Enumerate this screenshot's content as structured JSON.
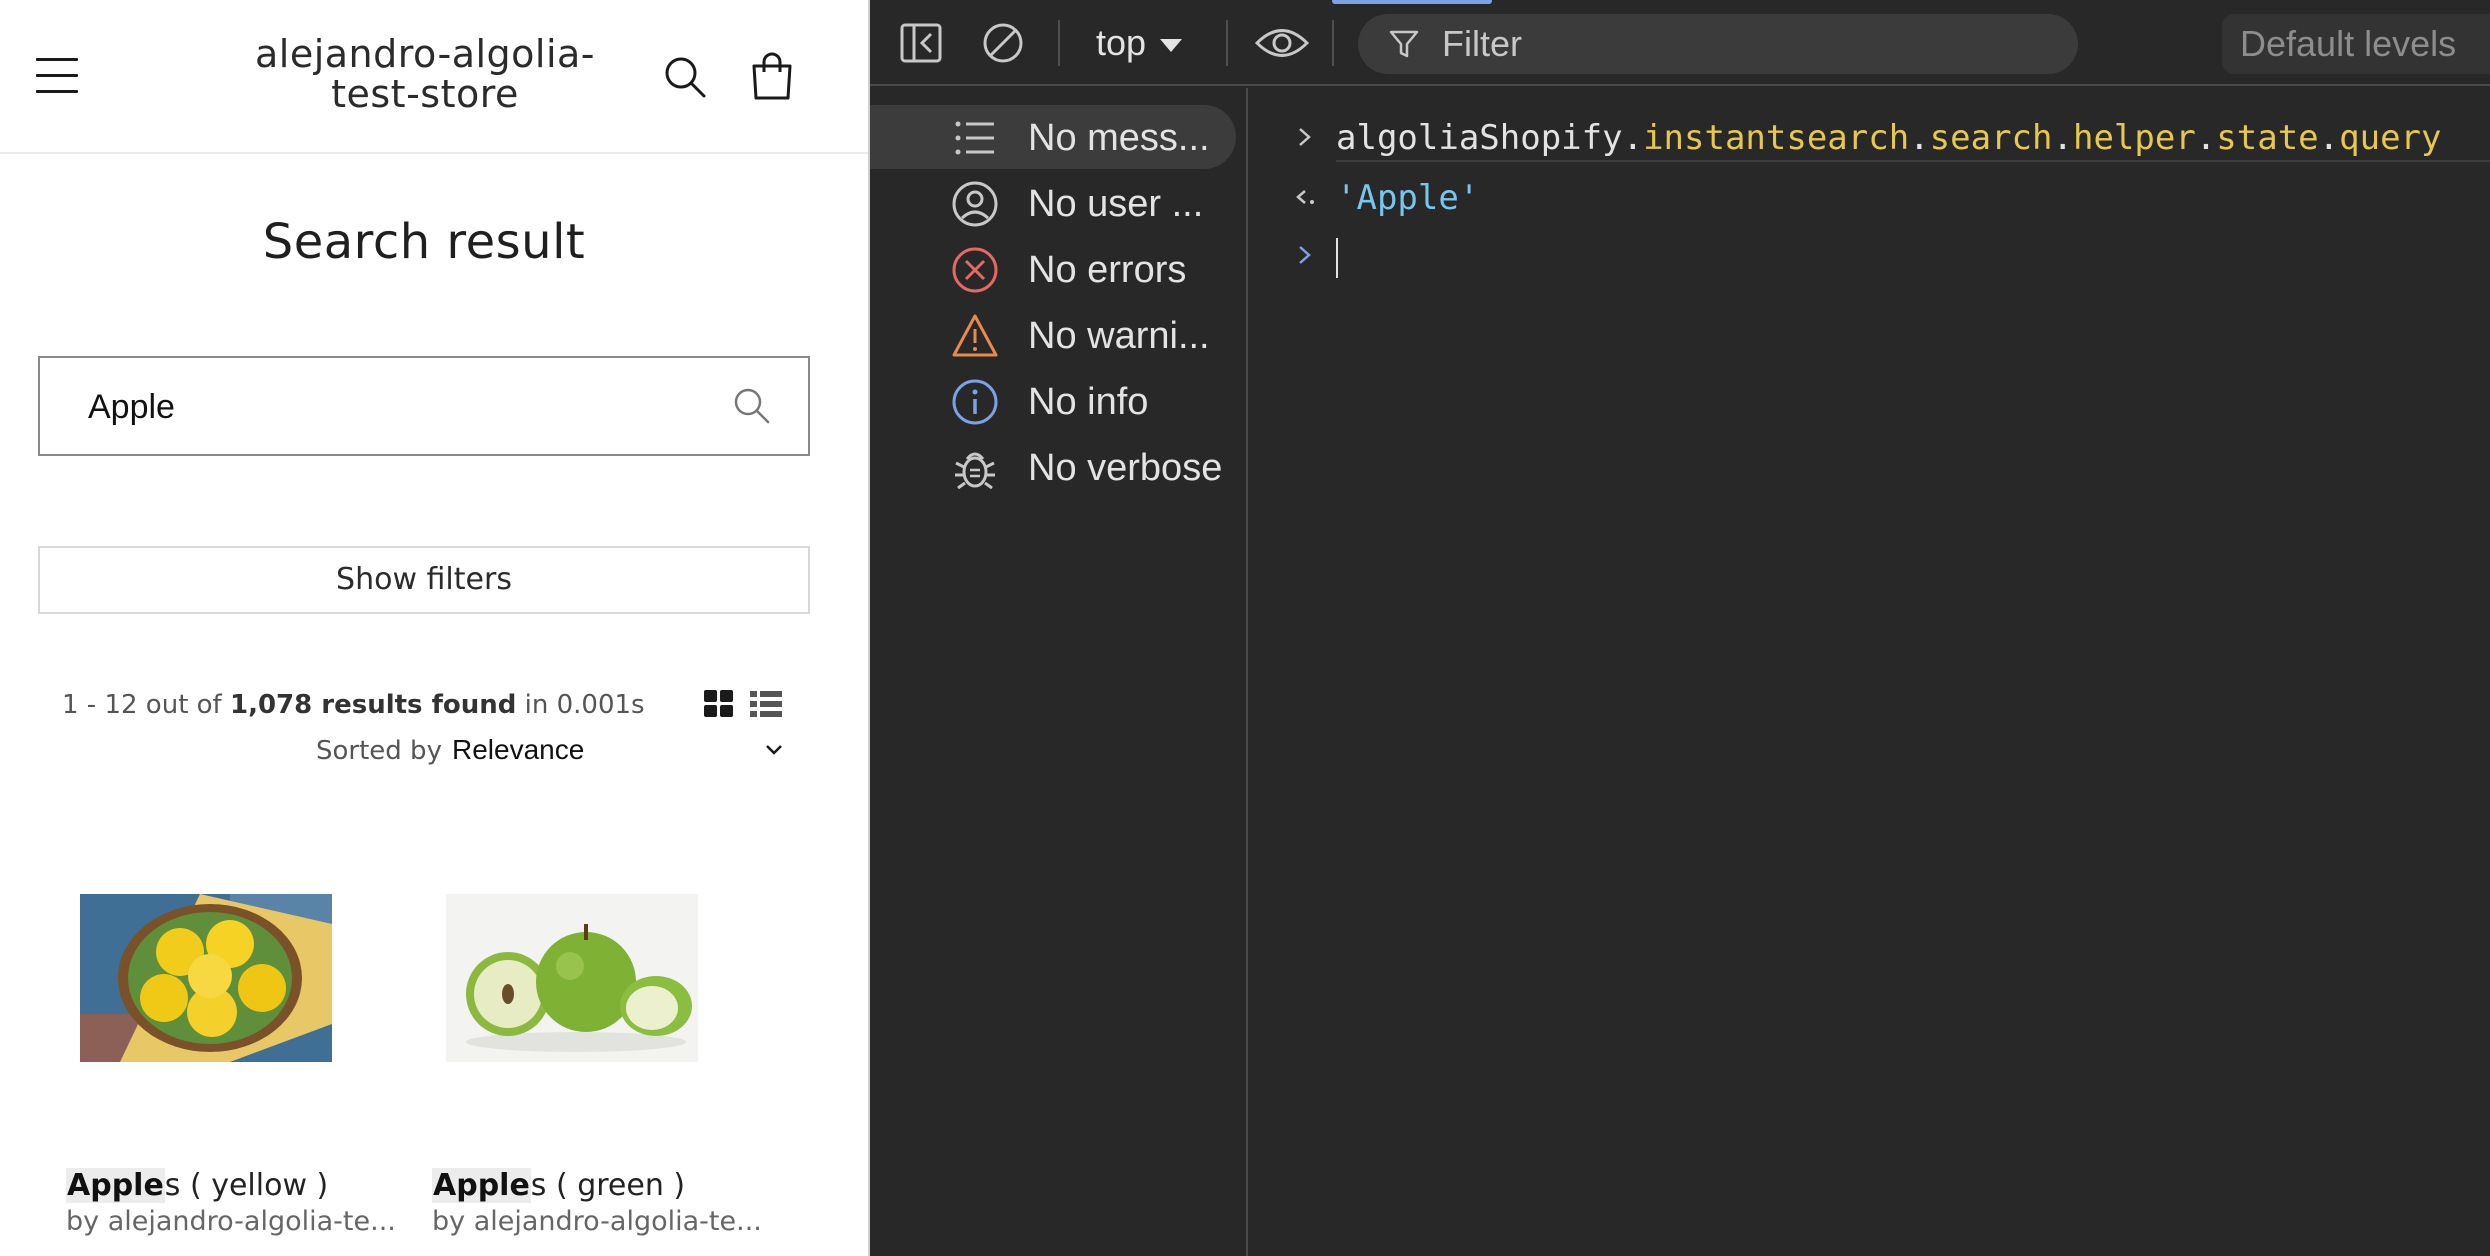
{
  "store": {
    "title": "alejandro-algolia-test-store",
    "heading": "Search result",
    "search": {
      "value": "Apple",
      "placeholder": ""
    },
    "filters_button": "Show filters",
    "stats": {
      "range": "1 - 12 out of",
      "count": "1,078 results found",
      "time": "in 0.001s"
    },
    "sort": {
      "label": "Sorted by",
      "value": "Relevance"
    },
    "products": [
      {
        "highlight": "Apple",
        "rest": "s ( yellow )",
        "vendor": "by alejandro-algolia-te..."
      },
      {
        "highlight": "Apple",
        "rest": "s ( green )",
        "vendor": "by alejandro-algolia-te..."
      }
    ]
  },
  "devtools": {
    "toolbar": {
      "context": "top",
      "filter_placeholder": "Filter",
      "levels": "Default levels"
    },
    "sidebar": [
      {
        "label": "No mess...",
        "icon": "list-icon"
      },
      {
        "label": "No user ...",
        "icon": "user-icon"
      },
      {
        "label": "No errors",
        "icon": "error-icon"
      },
      {
        "label": "No warni...",
        "icon": "warning-icon"
      },
      {
        "label": "No info",
        "icon": "info-icon"
      },
      {
        "label": "No verbose",
        "icon": "bug-icon"
      }
    ],
    "console": {
      "command_root": "algoliaShopify",
      "command_props": [
        "instantsearch",
        "search",
        "helper",
        "state",
        "query"
      ],
      "result": "'Apple'"
    },
    "colors": {
      "background": "#282828",
      "property": "#e6c84f",
      "string": "#76c6ee",
      "error": "#e46962",
      "warning": "#e8894f",
      "info": "#7ca1e4"
    }
  }
}
